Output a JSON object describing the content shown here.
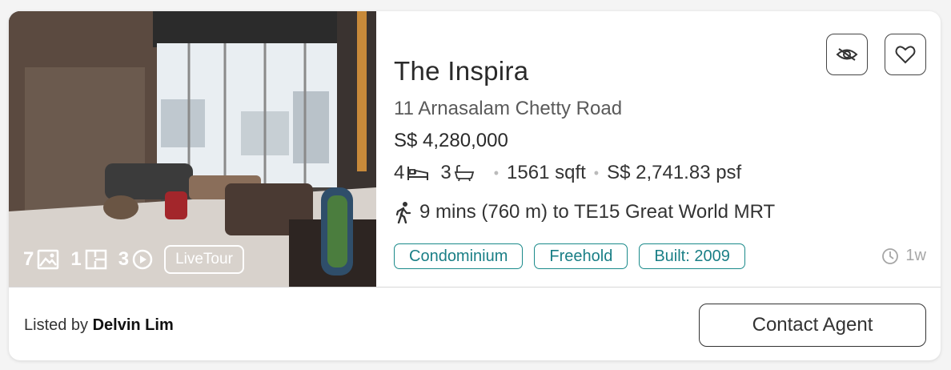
{
  "listing": {
    "title": "The Inspira",
    "address": "11 Arnasalam Chetty Road",
    "price": "S$ 4,280,000",
    "beds": "4",
    "baths": "3",
    "area": "1561 sqft",
    "psf": "S$ 2,741.83 psf",
    "mrt": "9 mins (760 m) to TE15 Great World MRT",
    "tags": [
      "Condominium",
      "Freehold",
      "Built: 2009"
    ],
    "age": "1w",
    "listed_prefix": "Listed by",
    "agent_name": "Delvin Lim"
  },
  "media": {
    "photos": "7",
    "floorplans": "1",
    "videos": "3",
    "livetour_label": "LiveTour"
  },
  "actions": {
    "contact_label": "Contact Agent",
    "hide_icon": "eye-slash-icon",
    "favorite_icon": "heart-icon"
  },
  "colors": {
    "tag_accent": "#1a8a8a",
    "background": "#ffffff"
  }
}
